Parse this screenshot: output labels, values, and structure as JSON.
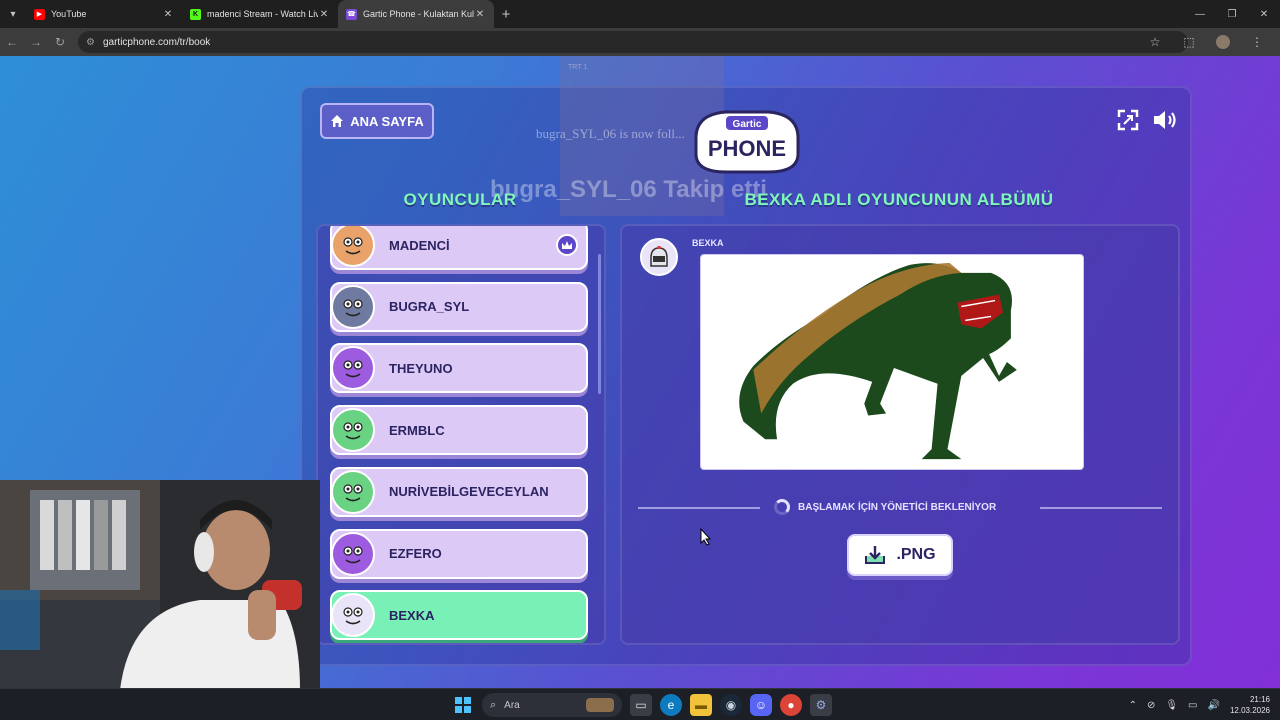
{
  "browser": {
    "tabs": [
      {
        "title": "YouTube",
        "active": false,
        "favicon_color": "#ff0000"
      },
      {
        "title": "madenci Stream - Watch Live o",
        "active": false,
        "favicon_color": "#53fc18"
      },
      {
        "title": "Gartic Phone - Kulaktan Kulağa",
        "active": true,
        "favicon_color": "#7b4bd6"
      }
    ],
    "url": "garticphone.com/tr/book"
  },
  "overlay": {
    "tag": "TRT 1",
    "follow_text": "bugra_SYL_06 is now foll...",
    "takip_text": "bugra_SYL_06 Takip etti"
  },
  "game": {
    "home_label": "ANA SAYFA",
    "logo_top": "Gartic",
    "logo_bottom": "PHONE",
    "players_heading": "OYUNCULAR",
    "album_heading": "BEXKA ADLI OYUNCUNUN ALBÜMÜ",
    "players": [
      {
        "name": "MADENCİ",
        "host": true,
        "me": false,
        "avatar_color": "#e9a36a"
      },
      {
        "name": "BUGRA_SYL",
        "host": false,
        "me": false,
        "avatar_color": "#6f7aa0"
      },
      {
        "name": "THEYUNO",
        "host": false,
        "me": false,
        "avatar_color": "#9d5be0"
      },
      {
        "name": "ERMBLC",
        "host": false,
        "me": false,
        "avatar_color": "#69d283"
      },
      {
        "name": "NURİVEBİLGEVECEYLAN",
        "host": false,
        "me": false,
        "avatar_color": "#69d283"
      },
      {
        "name": "EZFERO",
        "host": false,
        "me": false,
        "avatar_color": "#9d5be0"
      },
      {
        "name": "BEXKA",
        "host": false,
        "me": true,
        "avatar_color": "#e9e4f7"
      }
    ],
    "album": {
      "author": "BEXKA",
      "waiting_text": "BAŞLAMAK İÇİN YÖNETİCİ BEKLENİYOR",
      "download_label": ".PNG"
    }
  },
  "taskbar": {
    "search_placeholder": "Ara",
    "time": "21:16",
    "date": "12.03.2026"
  }
}
